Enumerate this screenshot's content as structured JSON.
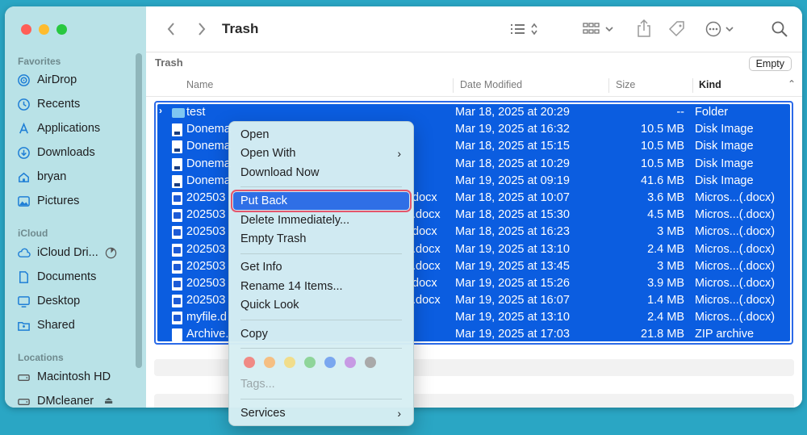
{
  "colors": {
    "desktop": "#2aa6c4",
    "sidebar": "#b9e2e7",
    "selection": "#0b5de0",
    "menu_highlight": "#2f6fe6",
    "highlight_outline": "#e4566c"
  },
  "toolbar": {
    "title": "Trash",
    "icons": [
      "chevron-left-icon",
      "chevron-right-icon",
      "list-view-icon",
      "grid-view-icon",
      "share-icon",
      "tag-icon",
      "more-icon",
      "search-icon"
    ]
  },
  "sidebar": {
    "favorites_label": "Favorites",
    "favorites": [
      {
        "label": "AirDrop",
        "icon": "airdrop-icon"
      },
      {
        "label": "Recents",
        "icon": "clock-icon"
      },
      {
        "label": "Applications",
        "icon": "applications-icon"
      },
      {
        "label": "Downloads",
        "icon": "download-icon"
      },
      {
        "label": "bryan",
        "icon": "home-icon"
      },
      {
        "label": "Pictures",
        "icon": "pictures-icon"
      }
    ],
    "icloud_label": "iCloud",
    "icloud": [
      {
        "label": "iCloud Dri...",
        "icon": "cloud-icon"
      },
      {
        "label": "Documents",
        "icon": "document-icon"
      },
      {
        "label": "Desktop",
        "icon": "desktop-icon"
      },
      {
        "label": "Shared",
        "icon": "shared-folder-icon"
      }
    ],
    "locations_label": "Locations",
    "locations": [
      {
        "label": "Macintosh HD",
        "icon": "disk-icon"
      },
      {
        "label": "DMcleaner",
        "icon": "disk-icon"
      }
    ]
  },
  "pathbar": {
    "label": "Trash",
    "empty_button": "Empty"
  },
  "columns": {
    "name": "Name",
    "date": "Date Modified",
    "size": "Size",
    "kind": "Kind"
  },
  "files": [
    {
      "name": "test",
      "tail": "",
      "date": "Mar 18, 2025 at 20:29",
      "size": "--",
      "kind": "Folder",
      "icon": "folder"
    },
    {
      "name": "Donema",
      "tail": "",
      "date": "Mar 19, 2025 at 16:32",
      "size": "10.5 MB",
      "kind": "Disk Image",
      "icon": "img"
    },
    {
      "name": "Donema",
      "tail": "",
      "date": "Mar 18, 2025 at 15:15",
      "size": "10.5 MB",
      "kind": "Disk Image",
      "icon": "img"
    },
    {
      "name": "Donema",
      "tail": "",
      "date": "Mar 18, 2025 at 10:29",
      "size": "10.5 MB",
      "kind": "Disk Image",
      "icon": "img"
    },
    {
      "name": "Donema",
      "tail": "",
      "date": "Mar 19, 2025 at 09:19",
      "size": "41.6 MB",
      "kind": "Disk Image",
      "icon": "img"
    },
    {
      "name": "202503",
      "tail": "docx",
      "date": "Mar 18, 2025 at 10:07",
      "size": "3.6 MB",
      "kind": "Micros...(.docx)",
      "icon": "doc"
    },
    {
      "name": "202503",
      "tail": ".docx",
      "date": "Mar 18, 2025 at 15:30",
      "size": "4.5 MB",
      "kind": "Micros...(.docx)",
      "icon": "doc"
    },
    {
      "name": "202503",
      "tail": "docx",
      "date": "Mar 18, 2025 at 16:23",
      "size": "3 MB",
      "kind": "Micros...(.docx)",
      "icon": "doc"
    },
    {
      "name": "202503",
      "tail": ".docx",
      "date": "Mar 19, 2025 at 13:10",
      "size": "2.4 MB",
      "kind": "Micros...(.docx)",
      "icon": "doc"
    },
    {
      "name": "202503",
      "tail": ".docx",
      "date": "Mar 19, 2025 at 13:45",
      "size": "3 MB",
      "kind": "Micros...(.docx)",
      "icon": "doc"
    },
    {
      "name": "202503",
      "tail": "docx",
      "date": "Mar 19, 2025 at 15:26",
      "size": "3.9 MB",
      "kind": "Micros...(.docx)",
      "icon": "doc"
    },
    {
      "name": "202503",
      "tail": ".docx",
      "date": "Mar 19, 2025 at 16:07",
      "size": "1.4 MB",
      "kind": "Micros...(.docx)",
      "icon": "doc"
    },
    {
      "name": "myfile.d",
      "tail": "",
      "date": "Mar 19, 2025 at 13:10",
      "size": "2.4 MB",
      "kind": "Micros...(.docx)",
      "icon": "doc"
    },
    {
      "name": "Archive.",
      "tail": "",
      "date": "Mar 19, 2025 at 17:03",
      "size": "21.8 MB",
      "kind": "ZIP archive",
      "icon": "zip"
    }
  ],
  "context_menu": {
    "open": "Open",
    "open_with": "Open With",
    "download_now": "Download Now",
    "put_back": "Put Back",
    "delete_immediately": "Delete Immediately...",
    "empty_trash": "Empty Trash",
    "get_info": "Get Info",
    "rename": "Rename 14 Items...",
    "quick_look": "Quick Look",
    "copy": "Copy",
    "tag_colors": [
      "#f08a85",
      "#f5bf83",
      "#f1dd8b",
      "#8fd59a",
      "#7aa7ef",
      "#c79ae4",
      "#a9a9a9"
    ],
    "tags": "Tags...",
    "services": "Services"
  }
}
